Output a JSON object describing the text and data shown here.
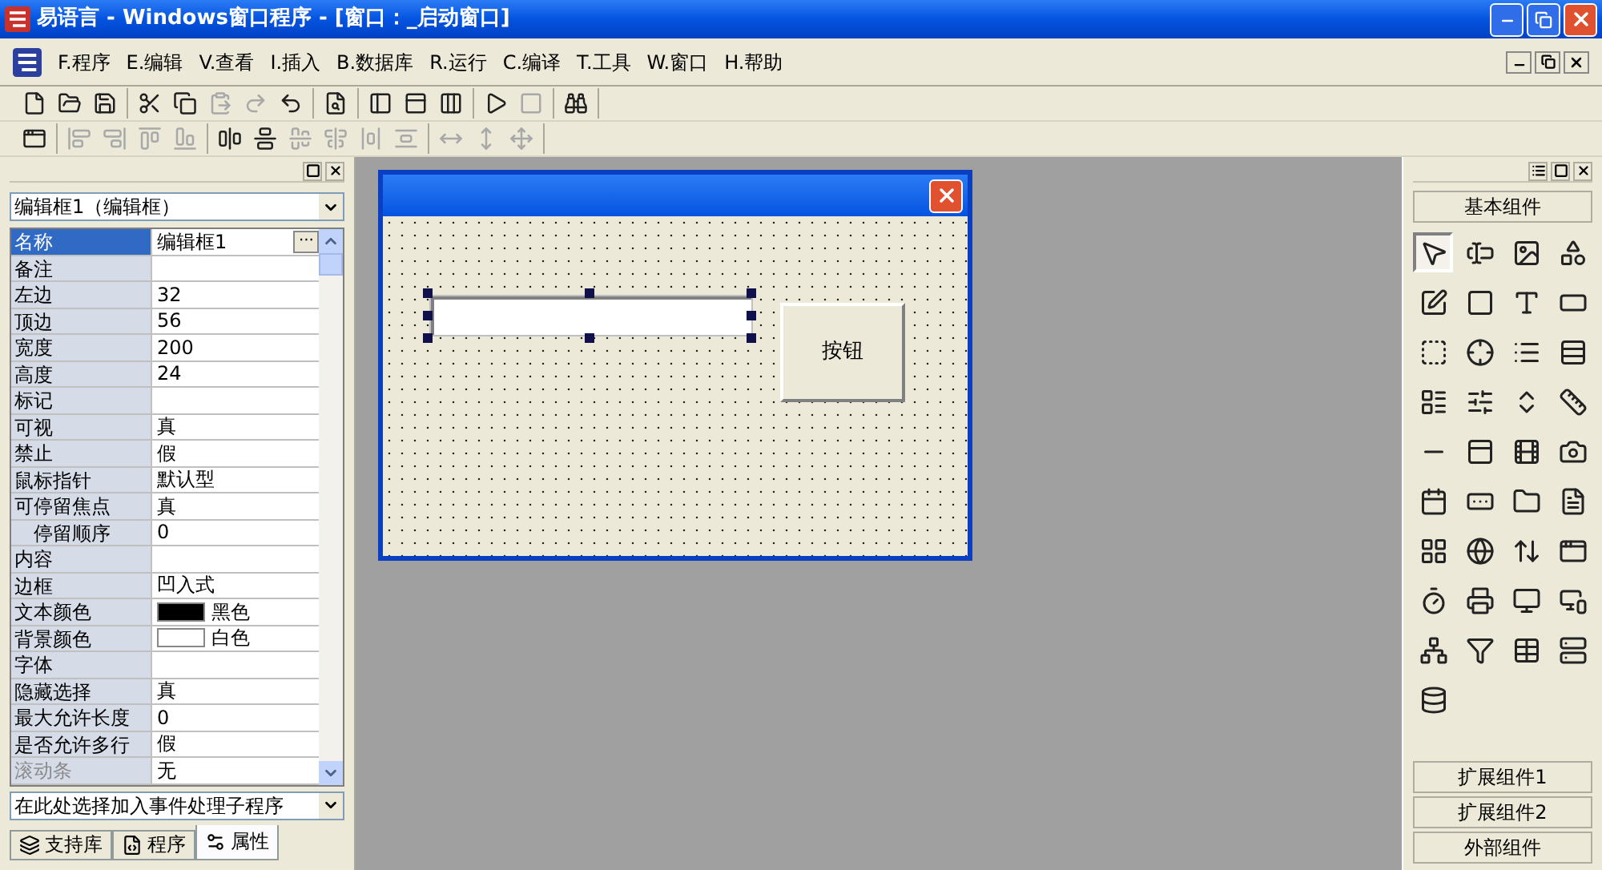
{
  "window": {
    "title": "易语言 - Windows窗口程序 - [窗口：_启动窗口]"
  },
  "menu": [
    "F.程序",
    "E.编辑",
    "V.查看",
    "I.插入",
    "B.数据库",
    "R.运行",
    "C.编译",
    "T.工具",
    "W.窗口",
    "H.帮助"
  ],
  "toolbars": [
    {
      "groups": [
        [
          {
            "disabled": false
          },
          {
            "disabled": false
          },
          {
            "disabled": false
          }
        ],
        [
          {
            "disabled": false
          },
          {
            "disabled": false
          },
          {
            "disabled": true
          },
          {
            "disabled": true
          },
          {
            "disabled": false
          }
        ],
        [
          {
            "disabled": false
          }
        ],
        [
          {
            "disabled": false
          },
          {
            "disabled": false
          },
          {
            "disabled": false
          }
        ],
        [
          {
            "disabled": false
          },
          {
            "disabled": true
          }
        ],
        [
          {
            "disabled": false
          }
        ]
      ]
    },
    {
      "groups": [
        [
          {
            "disabled": false
          }
        ],
        [
          {
            "disabled": true
          },
          {
            "disabled": true
          },
          {
            "disabled": true
          },
          {
            "disabled": true
          }
        ],
        [
          {
            "disabled": false
          },
          {
            "disabled": false
          },
          {
            "disabled": true
          },
          {
            "disabled": true
          },
          {
            "disabled": true
          },
          {
            "disabled": true
          }
        ],
        [
          {
            "disabled": true
          },
          {
            "disabled": true
          },
          {
            "disabled": true
          }
        ]
      ]
    }
  ],
  "properties": {
    "object": "编辑框1（编辑框）",
    "rows": [
      {
        "name": "名称",
        "value": "编辑框1",
        "kind": "text",
        "button": "···",
        "selected": true,
        "disabled": false
      },
      {
        "name": "备注",
        "value": "",
        "kind": "text",
        "selected": false,
        "disabled": false
      },
      {
        "name": "左边",
        "value": "32",
        "kind": "text",
        "selected": false,
        "disabled": false
      },
      {
        "name": "顶边",
        "value": "56",
        "kind": "text",
        "selected": false,
        "disabled": false
      },
      {
        "name": "宽度",
        "value": "200",
        "kind": "text",
        "selected": false,
        "disabled": false
      },
      {
        "name": "高度",
        "value": "24",
        "kind": "text",
        "selected": false,
        "disabled": false
      },
      {
        "name": "标记",
        "value": "",
        "kind": "text",
        "selected": false,
        "disabled": false
      },
      {
        "name": "可视",
        "value": "真",
        "kind": "text",
        "selected": false,
        "disabled": false
      },
      {
        "name": "禁止",
        "value": "假",
        "kind": "text",
        "selected": false,
        "disabled": false
      },
      {
        "name": "鼠标指针",
        "value": "默认型",
        "kind": "text",
        "selected": false,
        "disabled": false
      },
      {
        "name": "可停留焦点",
        "value": "真",
        "kind": "text",
        "selected": false,
        "disabled": false,
        "children": [
          {
            "name": "停留顺序",
            "value": "0",
            "kind": "text",
            "selected": false,
            "disabled": false
          }
        ]
      },
      {
        "name": "内容",
        "value": "",
        "kind": "text",
        "selected": false,
        "disabled": false
      },
      {
        "name": "边框",
        "value": "凹入式",
        "kind": "text",
        "selected": false,
        "disabled": false
      },
      {
        "name": "文本颜色",
        "value": "黑色",
        "kind": "color",
        "color": "#000000",
        "selected": false,
        "disabled": false
      },
      {
        "name": "背景颜色",
        "value": "白色",
        "kind": "color",
        "color": "#ffffff",
        "selected": false,
        "disabled": false
      },
      {
        "name": "字体",
        "value": "",
        "kind": "text",
        "selected": false,
        "disabled": false
      },
      {
        "name": "隐藏选择",
        "value": "真",
        "kind": "text",
        "selected": false,
        "disabled": false
      },
      {
        "name": "最大允许长度",
        "value": "0",
        "kind": "text",
        "selected": false,
        "disabled": false
      },
      {
        "name": "是否允许多行",
        "value": "假",
        "kind": "text",
        "selected": false,
        "disabled": false
      },
      {
        "name": "滚动条",
        "value": "无",
        "kind": "text",
        "selected": false,
        "disabled": true
      }
    ]
  },
  "event_select": "在此处选择加入事件处理子程序",
  "tabs": [
    {
      "label": "支持库",
      "selected": false
    },
    {
      "label": "程序",
      "selected": false
    },
    {
      "label": "属性",
      "selected": true
    }
  ],
  "designer": {
    "edit": {
      "selected": true
    },
    "button": "按钮"
  },
  "components": {
    "title": "基本组件",
    "items": [
      {
        "selected": true
      },
      {
        "selected": false
      },
      {
        "selected": false
      },
      {
        "selected": false
      },
      {
        "selected": false
      },
      {
        "selected": false
      },
      {
        "selected": false
      },
      {
        "selected": false
      },
      {
        "selected": false
      },
      {
        "selected": false
      },
      {
        "selected": false
      },
      {
        "selected": false
      },
      {
        "selected": false
      },
      {
        "selected": false
      },
      {
        "selected": false
      },
      {
        "selected": false
      },
      {
        "selected": false
      },
      {
        "selected": false
      },
      {
        "selected": false
      },
      {
        "selected": false
      },
      {
        "selected": false
      },
      {
        "selected": false
      },
      {
        "selected": false
      },
      {
        "selected": false
      },
      {
        "selected": false
      },
      {
        "selected": false
      },
      {
        "selected": false
      },
      {
        "selected": false
      },
      {
        "selected": false
      },
      {
        "selected": false
      },
      {
        "selected": false
      },
      {
        "selected": false
      },
      {
        "selected": false
      },
      {
        "selected": false
      },
      {
        "selected": false
      },
      {
        "selected": false
      },
      {
        "selected": false
      }
    ],
    "groups": [
      "扩展组件1",
      "扩展组件2",
      "外部组件"
    ]
  }
}
